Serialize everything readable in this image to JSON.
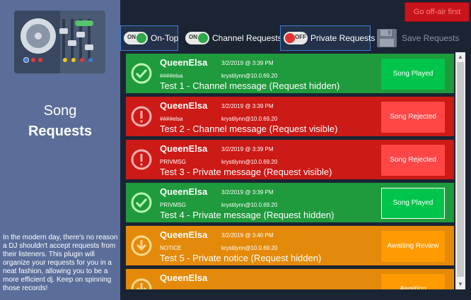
{
  "sidebar": {
    "title_line1": "Song",
    "title_line2": "Requests",
    "description": "In the modern day, there's no reason a DJ shouldn't accept requests from their listeners. This plugin will organize your requests for you in a neat fashion, allowing you to be a more efficient dj. Keep on spinning those records!"
  },
  "header": {
    "go_off_air": "Go off-air first"
  },
  "toolbar": {
    "on_top": {
      "state": "ON",
      "label": "On-Top"
    },
    "channel_requests": {
      "state": "ON",
      "label": "Channel Requests"
    },
    "private_requests": {
      "state": "OFF",
      "label": "Private Requests"
    },
    "save_requests": {
      "label": "Save Requests"
    }
  },
  "colors": {
    "accepted": "#1f9a3c",
    "rejected": "#cc1a16",
    "pending": "#e48a0a"
  },
  "requests": [
    {
      "name": "QueenElsa",
      "time": "3/2/2019 @ 3:39 PM",
      "tag": "####elsa",
      "address": "krystilynn@10.0.69.20",
      "message": "Test 1 - Channel message (Request hidden)",
      "status": "Song Played",
      "kind": "accepted",
      "icon": "check-circle-icon"
    },
    {
      "name": "QueenElsa",
      "time": "3/2/2019 @ 3:39 PM",
      "tag": "####elsa",
      "address": "krystilynn@10.0.69.20",
      "message": "Test 2 - Channel message (Request visible)",
      "status": "Song Rejected",
      "kind": "rejected",
      "icon": "exclamation-circle-icon"
    },
    {
      "name": "QueenElsa",
      "time": "3/2/2019 @ 3:39 PM",
      "tag": "PRIVMSG",
      "address": "krystilynn@10.0.69.20",
      "message": "Test 3 - Private message (Request visible)",
      "status": "Song Rejected",
      "kind": "rejected",
      "icon": "exclamation-circle-icon"
    },
    {
      "name": "QueenElsa",
      "time": "3/2/2019 @ 3:39 PM",
      "tag": "PRIVMSG",
      "address": "krystilynn@10.0.69.20",
      "message": "Test 4 - Private message (Request hidden)",
      "status": "Song Played",
      "kind": "accepted",
      "icon": "check-circle-icon"
    },
    {
      "name": "QueenElsa",
      "time": "3/2/2019 @ 3:40 PM",
      "tag": "NOTICE",
      "address": "krystilynn@10.0.69.20",
      "message": "Test 5 - Private notice (Request hidden)",
      "status": "Awaiting Review",
      "kind": "pending",
      "icon": "arrow-down-circle-icon"
    },
    {
      "name": "QueenElsa",
      "time": "",
      "tag": "",
      "address": "",
      "message": "",
      "status": "Awaiting",
      "kind": "pending",
      "icon": "arrow-down-circle-icon"
    }
  ]
}
